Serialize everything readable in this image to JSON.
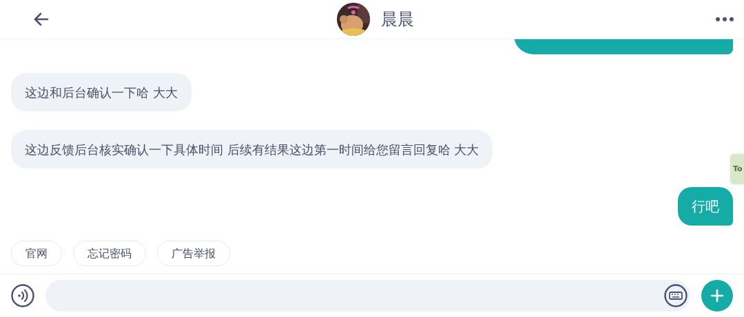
{
  "header": {
    "title": "晨晨"
  },
  "messages": [
    {
      "outgoing": true,
      "clipped": true
    },
    {
      "outgoing": false,
      "text": "这边和后台确认一下哈 大大"
    },
    {
      "outgoing": false,
      "text": "这边反馈后台核实确认一下具体时间 后续有结果这边第一时间给您留言回复哈 大大"
    },
    {
      "outgoing": true,
      "text": "行吧"
    }
  ],
  "floating_tab": {
    "label": "To"
  },
  "quick_replies": [
    "官网",
    "忘记密码",
    "广告举报"
  ]
}
